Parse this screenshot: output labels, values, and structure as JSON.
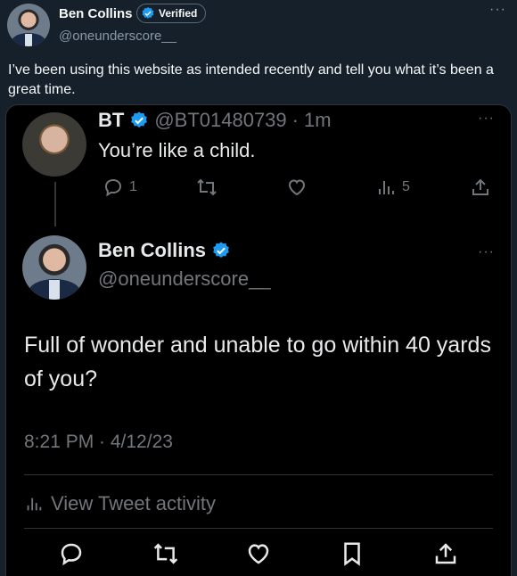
{
  "outer": {
    "name": "Ben Collins",
    "verified_label": "Verified",
    "handle": "@oneunderscore__",
    "more": "···",
    "text": "I’ve been using this website as intended recently and tell you what it’s been a great time."
  },
  "quoted": {
    "name": "BT",
    "handle": "@BT01480739",
    "separator": "·",
    "time": "1m",
    "text": "You’re like a child.",
    "reply_count": "1",
    "views_count": "5",
    "more": "···"
  },
  "main": {
    "name": "Ben Collins",
    "handle": "@oneunderscore__",
    "text": "Full of wonder and unable to go within 40 yards of you?",
    "timestamp": "8:21 PM · 4/12/23",
    "activity_label": "View Tweet activity",
    "more": "···"
  },
  "colors": {
    "verified": "#1d9bf0",
    "bg": "#15202b",
    "card": "#000000"
  }
}
